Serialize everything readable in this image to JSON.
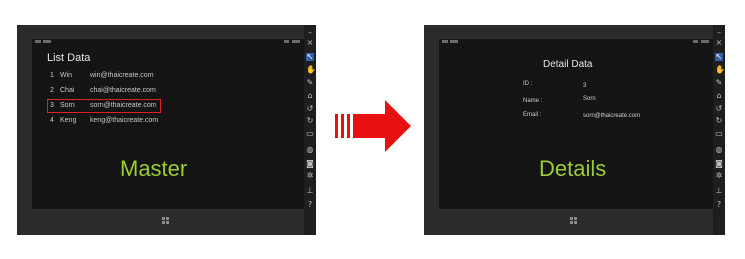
{
  "left_panel": {
    "title": "List Data",
    "rows": [
      {
        "id": "1",
        "name": "Win",
        "email": "win@thaicreate.com"
      },
      {
        "id": "2",
        "name": "Chai",
        "email": "chai@thaicreate.com"
      },
      {
        "id": "3",
        "name": "Sorn",
        "email": "sorn@thaicreate.com",
        "selected": true
      },
      {
        "id": "4",
        "name": "Keng",
        "email": "keng@thaicreate.com"
      }
    ],
    "caption": "Master"
  },
  "right_panel": {
    "title": "Detail Data",
    "fields": [
      {
        "label": "ID :",
        "value": "3"
      },
      {
        "label": "Name :",
        "value": "Sorn"
      },
      {
        "label": "Email :",
        "value": "sorn@thaicreate.com"
      }
    ],
    "caption": "Details"
  },
  "arrow_color": "#e81010",
  "caption_color": "#9acd32",
  "selection_color": "#e02020",
  "toolbar_icons": [
    "pointer-icon",
    "hand-icon",
    "pen-icon",
    "highlighter-icon",
    "rotate-left-icon",
    "rotate-right-icon",
    "monitor-icon",
    "globe-icon",
    "camera-icon",
    "settings-icon",
    "more-icon",
    "help-icon"
  ]
}
